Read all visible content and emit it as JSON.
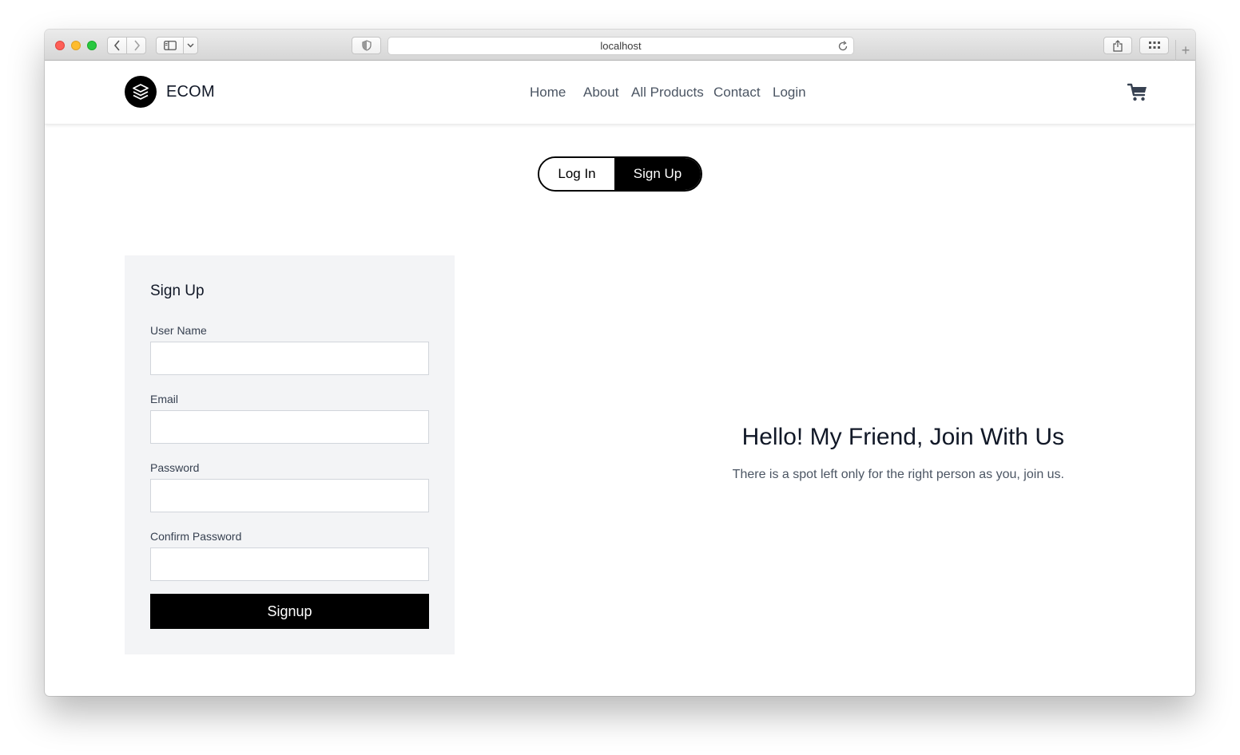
{
  "browser": {
    "address": "localhost",
    "new_tab_glyph": "+"
  },
  "site": {
    "brand": "ECOM",
    "nav": [
      "Home",
      "About",
      "All Products",
      "Contact",
      "Login"
    ],
    "cart_icon": "cart-icon"
  },
  "auth_toggle": {
    "login_label": "Log In",
    "signup_label": "Sign Up",
    "active": "Sign Up"
  },
  "form": {
    "title": "Sign Up",
    "fields": [
      {
        "label": "User Name",
        "value": ""
      },
      {
        "label": "Email",
        "value": ""
      },
      {
        "label": "Password",
        "value": ""
      },
      {
        "label": "Confirm Password",
        "value": ""
      }
    ],
    "submit_label": "Signup"
  },
  "hero": {
    "title": "Hello! My Friend, Join With Us",
    "subtitle": "There is a spot left only for the right person as you, join us."
  }
}
